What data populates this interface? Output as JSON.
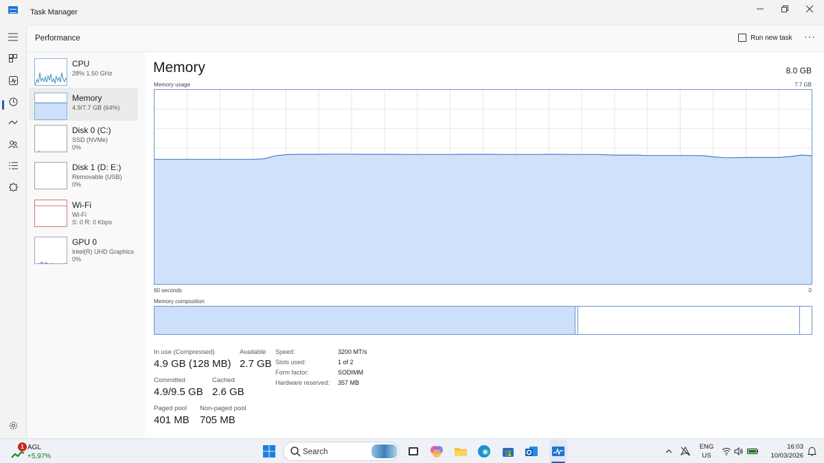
{
  "window": {
    "title": "Task Manager"
  },
  "header": {
    "page_title": "Performance",
    "run_new_task": "Run new task",
    "more": "···"
  },
  "resources": [
    {
      "title": "CPU",
      "sub1": "28%  1.50 GHz",
      "sub2": ""
    },
    {
      "title": "Memory",
      "sub1": "4.9/7.7 GB (64%)",
      "sub2": ""
    },
    {
      "title": "Disk 0 (C:)",
      "sub1": "SSD (NVMe)",
      "sub2": "0%"
    },
    {
      "title": "Disk 1 (D: E:)",
      "sub1": "Removable (USB)",
      "sub2": "0%"
    },
    {
      "title": "Wi-Fi",
      "sub1": "Wi-Fi",
      "sub2": "S: 0  R: 0 Kbps"
    },
    {
      "title": "GPU 0",
      "sub1": "Intel(R) UHD Graphics",
      "sub2": "0%"
    }
  ],
  "memory": {
    "title": "Memory",
    "total": "8.0 GB",
    "usage_label": "Memory usage",
    "usage_max": "7.7 GB",
    "time_left": "60 seconds",
    "time_right": "0",
    "composition_label": "Memory composition",
    "usage_fraction_history": [
      0.642,
      0.642,
      0.642,
      0.642,
      0.642,
      0.642,
      0.642,
      0.642,
      0.642,
      0.642,
      0.645,
      0.66,
      0.666,
      0.668,
      0.668,
      0.668,
      0.669,
      0.669,
      0.669,
      0.668,
      0.668,
      0.668,
      0.668,
      0.667,
      0.667,
      0.667,
      0.667,
      0.667,
      0.668,
      0.668,
      0.668,
      0.668,
      0.667,
      0.667,
      0.667,
      0.667,
      0.668,
      0.668,
      0.667,
      0.667,
      0.667,
      0.666,
      0.664,
      0.664,
      0.664,
      0.662,
      0.662,
      0.662,
      0.662,
      0.662,
      0.661,
      0.655,
      0.651,
      0.651,
      0.652,
      0.652,
      0.652,
      0.652,
      0.656,
      0.664,
      0.661
    ],
    "composition": {
      "in_use_fraction": 0.641,
      "standby_end_fraction": 0.982
    },
    "stats": [
      {
        "label": "In use (Compressed)",
        "value": "4.9 GB (128 MB)"
      },
      {
        "label": "Available",
        "value": "2.7 GB"
      },
      {
        "label": "Committed",
        "value": "4.9/9.5 GB"
      },
      {
        "label": "Cached",
        "value": "2.6 GB"
      },
      {
        "label": "Paged pool",
        "value": "401 MB"
      },
      {
        "label": "Non-paged pool",
        "value": "705 MB"
      }
    ],
    "specs": [
      {
        "label": "Speed:",
        "value": "3200 MT/s"
      },
      {
        "label": "Slots used:",
        "value": "1 of 2"
      },
      {
        "label": "Form factor:",
        "value": "SODIMM"
      },
      {
        "label": "Hardware reserved:",
        "value": "357 MB"
      }
    ]
  },
  "taskbar": {
    "stock_name": "AGL",
    "stock_change": "+5,97%",
    "stock_badge": "1",
    "search_placeholder": "Search",
    "lang": "ENG",
    "region": "US",
    "time": "16:03",
    "date": "10/03/2026"
  },
  "colors": {
    "accent": "#1a5fb4",
    "memory_fill": "#cce0fa",
    "memory_line": "#4a7cc9",
    "grid": "#e6e6e6"
  }
}
